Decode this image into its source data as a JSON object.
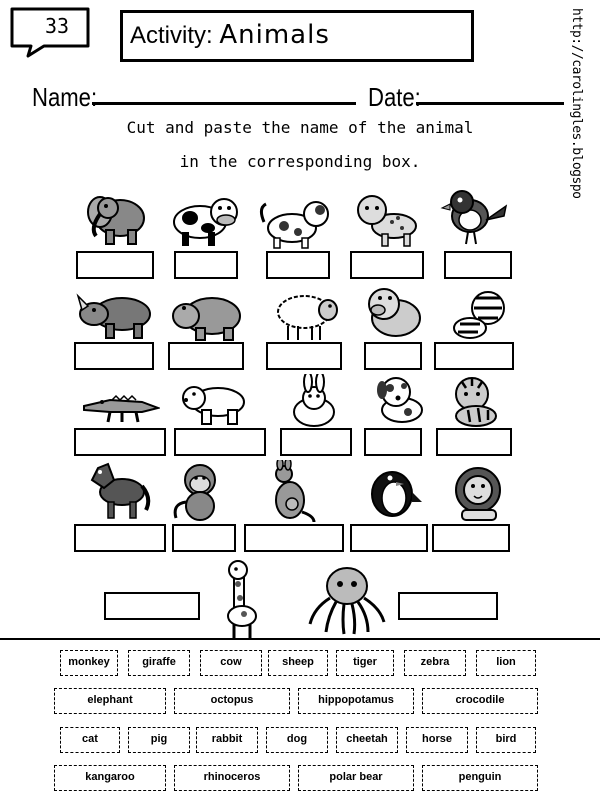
{
  "header": {
    "number": "33",
    "title_prefix": "Activity:",
    "title_subject": "Animals",
    "name_label": "Name:",
    "date_label": "Date:",
    "url": "http://carolingles.blogspot.com"
  },
  "instructions": {
    "line1": "Cut and paste the name of the animal",
    "line2": "in the corresponding box."
  },
  "animals": [
    {
      "row": 0,
      "icon": "elephant-icon"
    },
    {
      "row": 0,
      "icon": "cow-icon"
    },
    {
      "row": 0,
      "icon": "cat-icon"
    },
    {
      "row": 0,
      "icon": "cheetah-icon"
    },
    {
      "row": 0,
      "icon": "bird-icon"
    },
    {
      "row": 1,
      "icon": "rhinoceros-icon"
    },
    {
      "row": 1,
      "icon": "hippopotamus-icon"
    },
    {
      "row": 1,
      "icon": "sheep-icon"
    },
    {
      "row": 1,
      "icon": "pig-icon"
    },
    {
      "row": 1,
      "icon": "zebra-icon"
    },
    {
      "row": 2,
      "icon": "crocodile-icon"
    },
    {
      "row": 2,
      "icon": "polar-bear-icon"
    },
    {
      "row": 2,
      "icon": "rabbit-icon"
    },
    {
      "row": 2,
      "icon": "dog-icon"
    },
    {
      "row": 2,
      "icon": "tiger-icon"
    },
    {
      "row": 3,
      "icon": "horse-icon"
    },
    {
      "row": 3,
      "icon": "monkey-icon"
    },
    {
      "row": 3,
      "icon": "kangaroo-icon"
    },
    {
      "row": 3,
      "icon": "penguin-icon"
    },
    {
      "row": 3,
      "icon": "lion-icon"
    },
    {
      "row": 4,
      "icon": "giraffe-icon"
    },
    {
      "row": 4,
      "icon": "octopus-icon"
    }
  ],
  "word_bank": [
    [
      "monkey",
      "giraffe",
      "cow",
      "sheep",
      "tiger",
      "zebra",
      "lion"
    ],
    [
      "elephant",
      "octopus",
      "hippopotamus",
      "crocodile"
    ],
    [
      "cat",
      "pig",
      "rabbit",
      "dog",
      "cheetah",
      "horse",
      "bird"
    ],
    [
      "kangaroo",
      "rhinoceros",
      "polar bear",
      "penguin"
    ]
  ]
}
